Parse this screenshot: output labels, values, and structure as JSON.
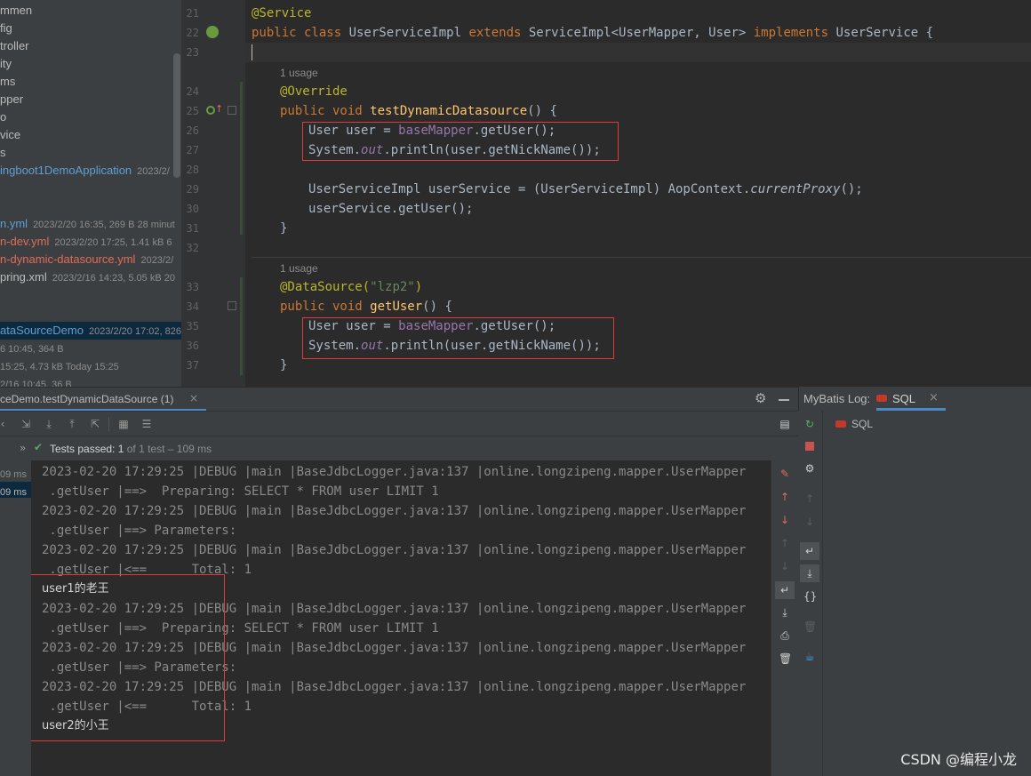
{
  "project": {
    "items": [
      {
        "label": "mmen",
        "meta": "",
        "style": ""
      },
      {
        "label": "fig",
        "meta": "",
        "style": ""
      },
      {
        "label": "troller",
        "meta": "",
        "style": ""
      },
      {
        "label": "ity",
        "meta": "",
        "style": ""
      },
      {
        "label": "ms",
        "meta": "",
        "style": ""
      },
      {
        "label": "pper",
        "meta": "",
        "style": ""
      },
      {
        "label": "o",
        "meta": "",
        "style": ""
      },
      {
        "label": "vice",
        "meta": "",
        "style": ""
      },
      {
        "label": "s",
        "meta": "",
        "style": ""
      },
      {
        "label": "ingboot1DemoApplication",
        "meta": "2023/2/",
        "style": "blue"
      },
      {
        "label": "n.yml",
        "meta": "2023/2/20 16:35, 269 B 28 minut",
        "style": "blue"
      },
      {
        "label": "n-dev.yml",
        "meta": "2023/2/20 17:25, 1.41 kB 6",
        "style": "red"
      },
      {
        "label": "n-dynamic-datasource.yml",
        "meta": "2023/2/",
        "style": "red"
      },
      {
        "label": "pring.xml",
        "meta": "2023/2/16 14:23, 5.05 kB 20",
        "style": ""
      },
      {
        "label": "ataSourceDemo",
        "meta": "2023/2/20 17:02, 826",
        "style": "selected"
      },
      {
        "label": "6 10:45, 364 B",
        "meta": "",
        "style": "meta"
      },
      {
        "label": "15:25, 4.73 kB Today 15:25",
        "meta": "",
        "style": "meta"
      },
      {
        "label": "2/16 10:45, 36 B",
        "meta": "",
        "style": "meta"
      }
    ]
  },
  "editor": {
    "line_numbers": [
      "21",
      "22",
      "23",
      "24",
      "25",
      "26",
      "27",
      "28",
      "29",
      "30",
      "31",
      "32",
      "33",
      "34",
      "35",
      "36",
      "37"
    ],
    "usage_1": "1 usage",
    "usage_2": "1 usage",
    "lines": {
      "l21_ann": "@Service",
      "l22_a": "public class ",
      "l22_b": "UserServiceImpl ",
      "l22_c": "extends ",
      "l22_d": "ServiceImpl<UserMapper, User> ",
      "l22_e": "implements ",
      "l22_f": "UserService {",
      "l24_ann": "@Override",
      "l25_kw": "public void ",
      "l25_fn": "testDynamicDatasource",
      "l25_rest": "() {",
      "l26_a": "User user = ",
      "l26_field": "baseMapper",
      "l26_b": ".getUser();",
      "l27_a": "System.",
      "l27_it": "out",
      "l27_b": ".println(user.getNickName());",
      "l29_a": "UserServiceImpl userService = (UserServiceImpl) AopContext.",
      "l29_it": "currentProxy",
      "l29_b": "();",
      "l30": "userService.getUser();",
      "l31": "}",
      "l33_ann": "@DataSource(",
      "l33_str": "\"lzp2\"",
      "l33_end": ")",
      "l34_kw": "public void ",
      "l34_fn": "getUser",
      "l34_rest": "() {",
      "l35_a": "User user = ",
      "l35_field": "baseMapper",
      "l35_b": ".getUser();",
      "l36_a": "System.",
      "l36_it": "out",
      "l36_b": ".println(user.getNickName());",
      "l37": "}"
    }
  },
  "run": {
    "tab_label": "ceDemo.testDynamicDataSource (1)",
    "status_prefix": "Tests passed: ",
    "status_count": "1",
    "status_suffix": " of 1 test – 109 ms",
    "tree_time_1": "09 ms",
    "tree_time_2": "09 ms",
    "console": [
      {
        "text": "2023-02-20 17:29:25 |DEBUG |main |BaseJdbcLogger.java:137 |online.longzipeng.mapper.UserMapper",
        "kind": "log"
      },
      {
        "text": " .getUser |==>  Preparing: SELECT * FROM user LIMIT 1",
        "kind": "log"
      },
      {
        "text": "2023-02-20 17:29:25 |DEBUG |main |BaseJdbcLogger.java:137 |online.longzipeng.mapper.UserMapper",
        "kind": "log"
      },
      {
        "text": " .getUser |==> Parameters: ",
        "kind": "log"
      },
      {
        "text": "2023-02-20 17:29:25 |DEBUG |main |BaseJdbcLogger.java:137 |online.longzipeng.mapper.UserMapper",
        "kind": "log"
      },
      {
        "text": " .getUser |<==      Total: 1",
        "kind": "log"
      },
      {
        "text": "user1的老王",
        "kind": "out"
      },
      {
        "text": "2023-02-20 17:29:25 |DEBUG |main |BaseJdbcLogger.java:137 |online.longzipeng.mapper.UserMapper",
        "kind": "log"
      },
      {
        "text": " .getUser |==>  Preparing: SELECT * FROM user LIMIT 1",
        "kind": "log"
      },
      {
        "text": "2023-02-20 17:29:25 |DEBUG |main |BaseJdbcLogger.java:137 |online.longzipeng.mapper.UserMapper",
        "kind": "log"
      },
      {
        "text": " .getUser |==> Parameters: ",
        "kind": "log"
      },
      {
        "text": "2023-02-20 17:29:25 |DEBUG |main |BaseJdbcLogger.java:137 |online.longzipeng.mapper.UserMapper",
        "kind": "log"
      },
      {
        "text": " .getUser |<==      Total: 1",
        "kind": "log"
      },
      {
        "text": "user2的小王",
        "kind": "out"
      }
    ]
  },
  "mybatis": {
    "title": "MyBatis Log:",
    "tab_label": "SQL",
    "item_label": "SQL"
  },
  "watermark": "CSDN @编程小龙",
  "colors": {
    "highlight_box": "#e03a3a",
    "pass_green": "#59a869"
  }
}
